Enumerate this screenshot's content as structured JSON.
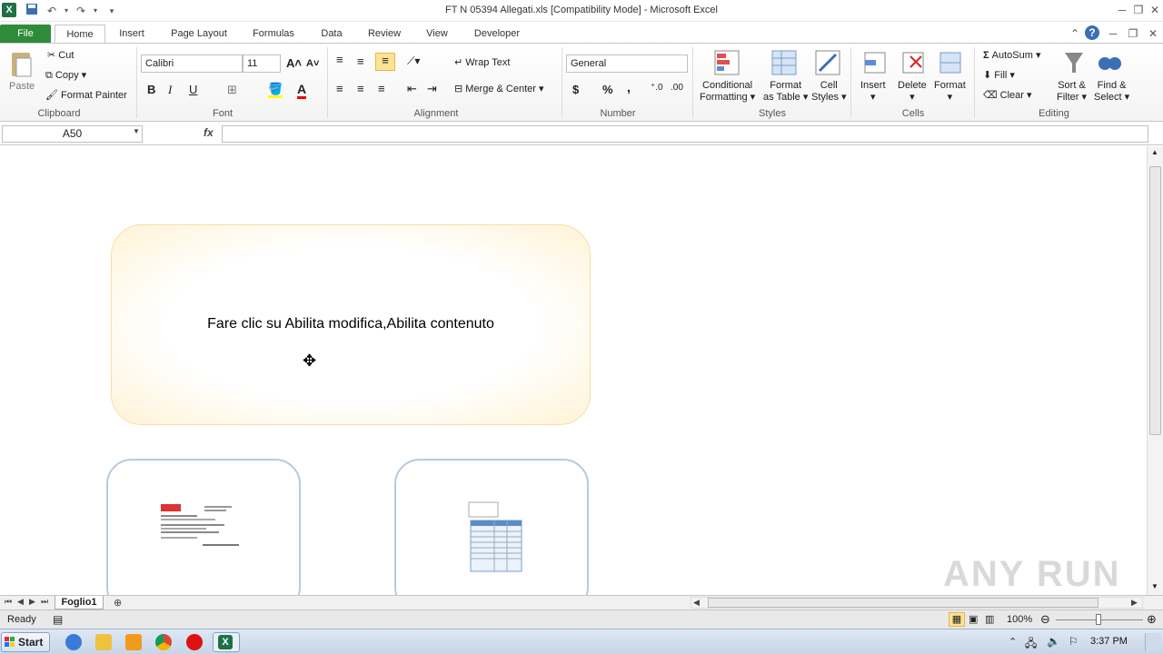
{
  "window": {
    "title": "FT N 05394 Allegati.xls  [Compatibility Mode]  -  Microsoft Excel"
  },
  "tabs": [
    "File",
    "Home",
    "Insert",
    "Page Layout",
    "Formulas",
    "Data",
    "Review",
    "View",
    "Developer"
  ],
  "ribbon": {
    "clipboard": {
      "paste": "Paste",
      "cut": "Cut",
      "copy": "Copy",
      "format_painter": "Format Painter",
      "label": "Clipboard"
    },
    "font": {
      "name": "Calibri",
      "size": "11",
      "bold": "B",
      "italic": "I",
      "underline": "U",
      "label": "Font"
    },
    "alignment": {
      "wrap_text": "Wrap Text",
      "merge_center": "Merge & Center",
      "label": "Alignment"
    },
    "number": {
      "format": "General",
      "currency": "$",
      "percent": "%",
      "comma": ",",
      "label": "Number"
    },
    "styles": {
      "conditional": "Conditional",
      "formatting": "Formatting",
      "format_as": "Format",
      "as_table": "as Table",
      "cell": "Cell",
      "cell_styles": "Styles",
      "label": "Styles"
    },
    "cells": {
      "insert": "Insert",
      "delete": "Delete",
      "format": "Format",
      "label": "Cells"
    },
    "editing": {
      "autosum": "AutoSum",
      "fill": "Fill",
      "clear": "Clear",
      "sort": "Sort &",
      "filter": "Filter",
      "find": "Find &",
      "select": "Select",
      "label": "Editing"
    }
  },
  "formula_bar": {
    "name_box": "A50",
    "fx": "fx",
    "value": ""
  },
  "sheet": {
    "notice": "Fare clic su Abilita modifica,Abilita contenuto"
  },
  "sheet_tabs": {
    "active": "Foglio1"
  },
  "status": {
    "ready": "Ready",
    "zoom": "100%"
  },
  "taskbar": {
    "start": "Start",
    "clock": "3:37 PM"
  },
  "watermark": "ANY RUN",
  "colors": {
    "file_tab": "#2e8b3a",
    "excel_green": "#1e7145",
    "notice_border": "#f6dfa6"
  }
}
